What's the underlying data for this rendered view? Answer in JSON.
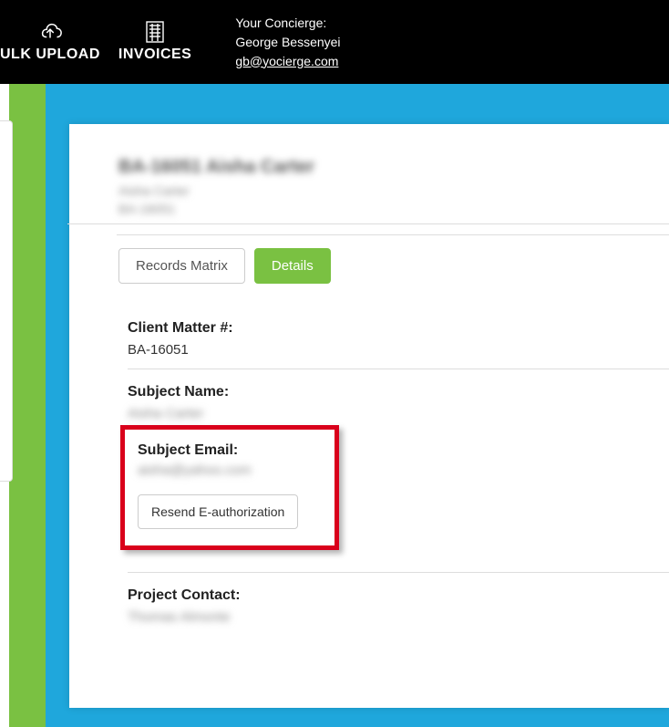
{
  "nav": {
    "bulk_upload": "ULK UPLOAD",
    "invoices": "INVOICES"
  },
  "concierge": {
    "label": "Your Concierge:",
    "name": "George Bessenyei",
    "email": "gb@yocierge.com"
  },
  "header": {
    "title": "BA-16051 Aisha Carter",
    "sub1": "Aisha Carter",
    "sub2": "BA-16051"
  },
  "tabs": {
    "records_matrix": "Records Matrix",
    "details": "Details"
  },
  "fields": {
    "client_matter_label": "Client Matter #:",
    "client_matter_value": "BA-16051",
    "subject_name_label": "Subject Name:",
    "subject_name_value": "Aisha Carter",
    "subject_email_label": "Subject Email:",
    "subject_email_value": "aisha@yahoo.com",
    "resend_btn": "Resend E-authorization",
    "project_contact_label": "Project Contact:",
    "project_contact_value": "Thomas Almonte"
  }
}
